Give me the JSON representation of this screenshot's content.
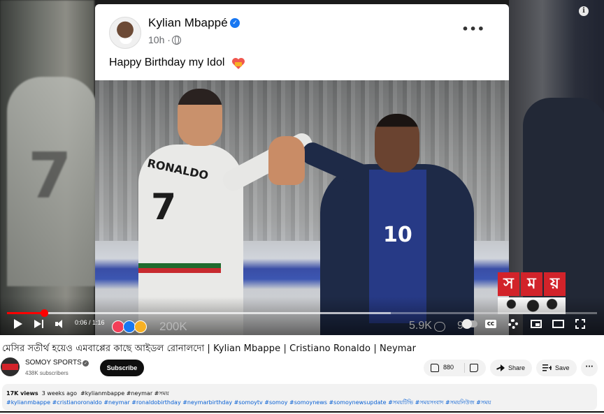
{
  "player": {
    "fb_post": {
      "author": "Kylian Mbappé",
      "time": "10h ·",
      "text": "Happy Birthday my Idol",
      "reaction_count": "200K",
      "comment_count": "5.9K",
      "share_count": "9",
      "photo_labels": {
        "jersey_name": "RONALDO",
        "jersey_number_left": "7",
        "jersey_number_right": "10"
      }
    },
    "watermark": {
      "letters": [
        "স",
        "ম",
        "য়"
      ]
    },
    "time_display": "0:06 / 1:16",
    "progress": {
      "played_fraction": 0.063,
      "buffered_fraction": 0.65
    },
    "colors": {
      "progress_red": "#ff0000",
      "fb_blue": "#1877f2",
      "somoy_red": "#d2232a"
    }
  },
  "video": {
    "title": "মেসির সতীর্থ হয়েও এমবাপ্পের কাছে আইডল রোনালদো | Kylian Mbappe | Cristiano Ronaldo | Neymar"
  },
  "channel": {
    "name": "SOMOY SPORTS",
    "subscribers": "438K subscribers",
    "subscribe_label": "Subscribe"
  },
  "actions": {
    "like_count": "880",
    "share_label": "Share",
    "save_label": "Save",
    "more_label": "···"
  },
  "description": {
    "views": "17K views",
    "date": "3 weeks ago",
    "inline_tags": "#kylianmbappe #neymar #সময়",
    "tags": "#kylianmbappe #cristianoronaldo #neymar #ronaldobirthday #neymarbirthday #somoytv #somoy #somoynews #somoynewsupdate #সময়টিভি #সময়সংবাদ #সময়নিউজ #সময়"
  },
  "icons": [
    "info-icon",
    "verified-icon",
    "globe-icon",
    "more-icon",
    "heart-icon",
    "play-icon",
    "next-icon",
    "volume-icon",
    "comment-icon",
    "cc-icon",
    "settings-icon",
    "miniplayer-icon",
    "theater-icon",
    "fullscreen-icon",
    "like-icon",
    "dislike-icon",
    "share-icon",
    "save-icon"
  ]
}
